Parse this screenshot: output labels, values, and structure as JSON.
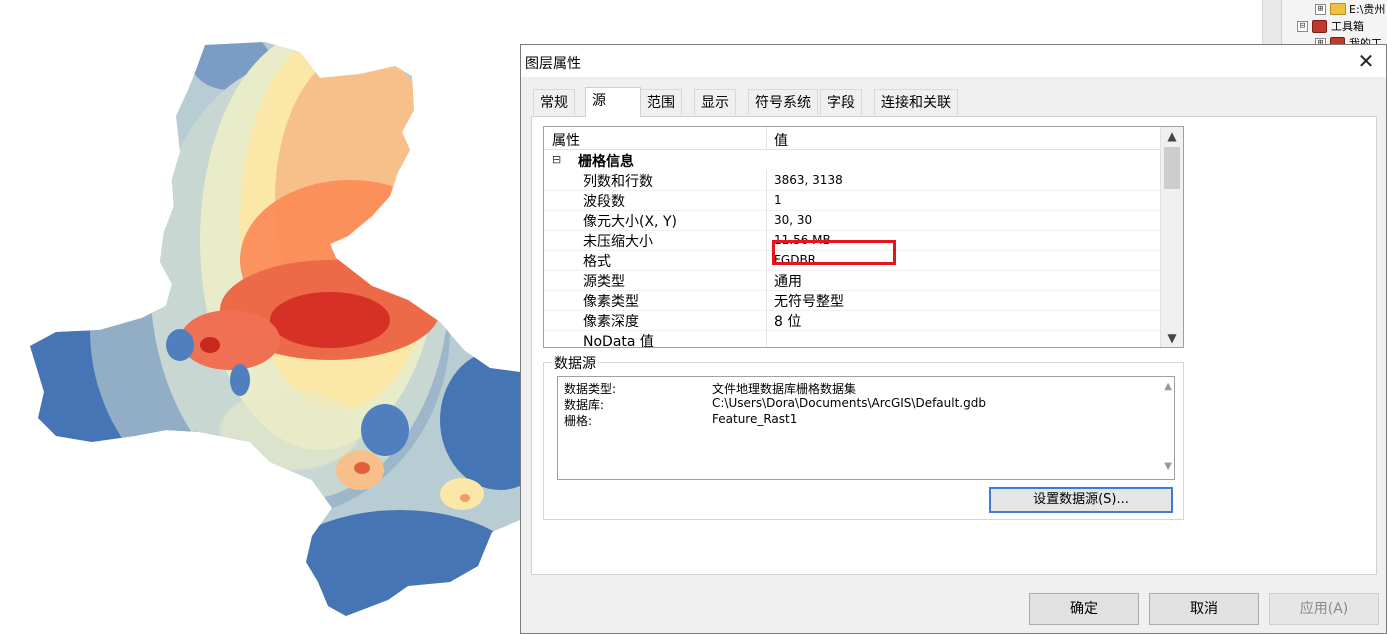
{
  "dialog": {
    "title": "图层属性",
    "close_glyph": "✕",
    "tabs": [
      "常规",
      "源",
      "范围",
      "显示",
      "符号系统",
      "字段",
      "连接和关联"
    ],
    "active_tab": "源"
  },
  "property_grid": {
    "header_property": "属性",
    "header_value": "值",
    "section_toggle": "⊟",
    "section_title": "栅格信息",
    "rows": [
      {
        "name": "列数和行数",
        "value": "3863, 3138"
      },
      {
        "name": "波段数",
        "value": "1"
      },
      {
        "name": "像元大小(X, Y)",
        "value": "30, 30"
      },
      {
        "name": "未压缩大小",
        "value": "11.56 MB"
      },
      {
        "name": "格式",
        "value": "FGDBR"
      },
      {
        "name": "源类型",
        "value": "通用"
      },
      {
        "name": "像素类型",
        "value": "无符号整型"
      },
      {
        "name": "像素深度",
        "value": "8 位"
      },
      {
        "name": "NoData 值",
        "value": ""
      }
    ]
  },
  "data_source": {
    "legend": "数据源",
    "lines": [
      {
        "key": "数据类型:",
        "value": "文件地理数据库栅格数据集"
      },
      {
        "key": "数据库:",
        "value": "C:\\Users\\Dora\\Documents\\ArcGIS\\Default.gdb"
      },
      {
        "key": "栅格:",
        "value": "Feature_Rast1"
      }
    ],
    "set_button": "设置数据源(S)..."
  },
  "buttons": {
    "ok": "确定",
    "cancel": "取消",
    "apply": "应用(A)"
  },
  "catalog": {
    "items": [
      {
        "toggle": "⊞",
        "label": "E:\\贵州"
      },
      {
        "toggle": "⊟",
        "label": "工具箱"
      },
      {
        "toggle": "⊞",
        "label": "我的工"
      }
    ]
  },
  "colors": {
    "highlight_box": "#e5141f",
    "map_ramp": [
      "#4575b4",
      "#91bfdb",
      "#e0f3f8",
      "#ffffbf",
      "#fee090",
      "#fc8d59",
      "#d73027"
    ]
  }
}
